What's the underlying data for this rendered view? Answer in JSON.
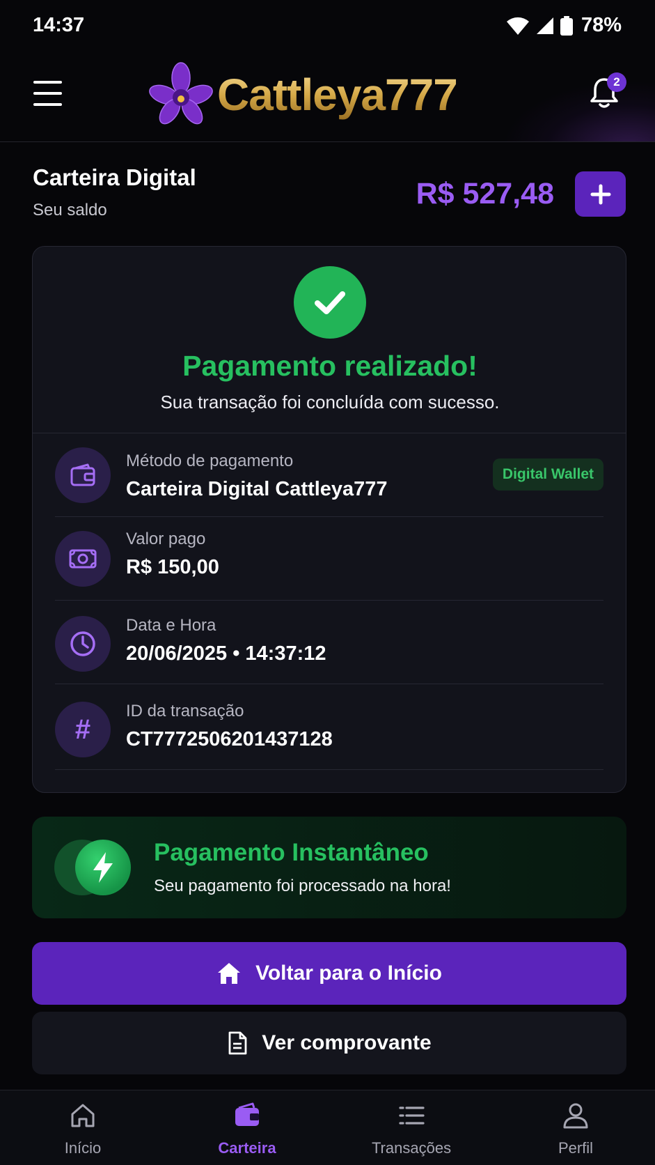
{
  "status_bar": {
    "time": "14:37",
    "battery": "78%"
  },
  "header": {
    "brand": "Cattleya777",
    "notifications_count": "2"
  },
  "wallet": {
    "title": "Carteira Digital",
    "subtitle": "Seu saldo",
    "balance": "R$ 527,48"
  },
  "payment": {
    "title": "Pagamento realizado!",
    "subtitle": "Sua transação foi concluída com sucesso.",
    "details": [
      {
        "label": "Método de pagamento",
        "value": "Carteira Digital Cattleya777",
        "badge": "Digital Wallet",
        "icon": "wallet-icon"
      },
      {
        "label": "Valor pago",
        "value": "R$ 150,00",
        "icon": "cash-icon"
      },
      {
        "label": "Data e Hora",
        "value": "20/06/2025 • 14:37:12",
        "icon": "clock-icon"
      },
      {
        "label": "ID da transação",
        "value": "CT7772506201437128",
        "icon": "hash-icon",
        "glyph": "#"
      }
    ]
  },
  "instant": {
    "title": "Pagamento Instantâneo",
    "subtitle": "Seu pagamento foi processado na hora!"
  },
  "actions": {
    "primary": "Voltar para o Início",
    "secondary": "Ver comprovante"
  },
  "nav": [
    {
      "label": "Início",
      "icon": "home-icon"
    },
    {
      "label": "Carteira",
      "icon": "wallet-icon",
      "active": true
    },
    {
      "label": "Transações",
      "icon": "list-icon"
    },
    {
      "label": "Perfil",
      "icon": "user-icon"
    }
  ],
  "colors": {
    "accent": "#5b24bb",
    "accent_text": "#9a5cf3",
    "success": "#27c060",
    "background": "#060609",
    "card": "#12131b"
  }
}
